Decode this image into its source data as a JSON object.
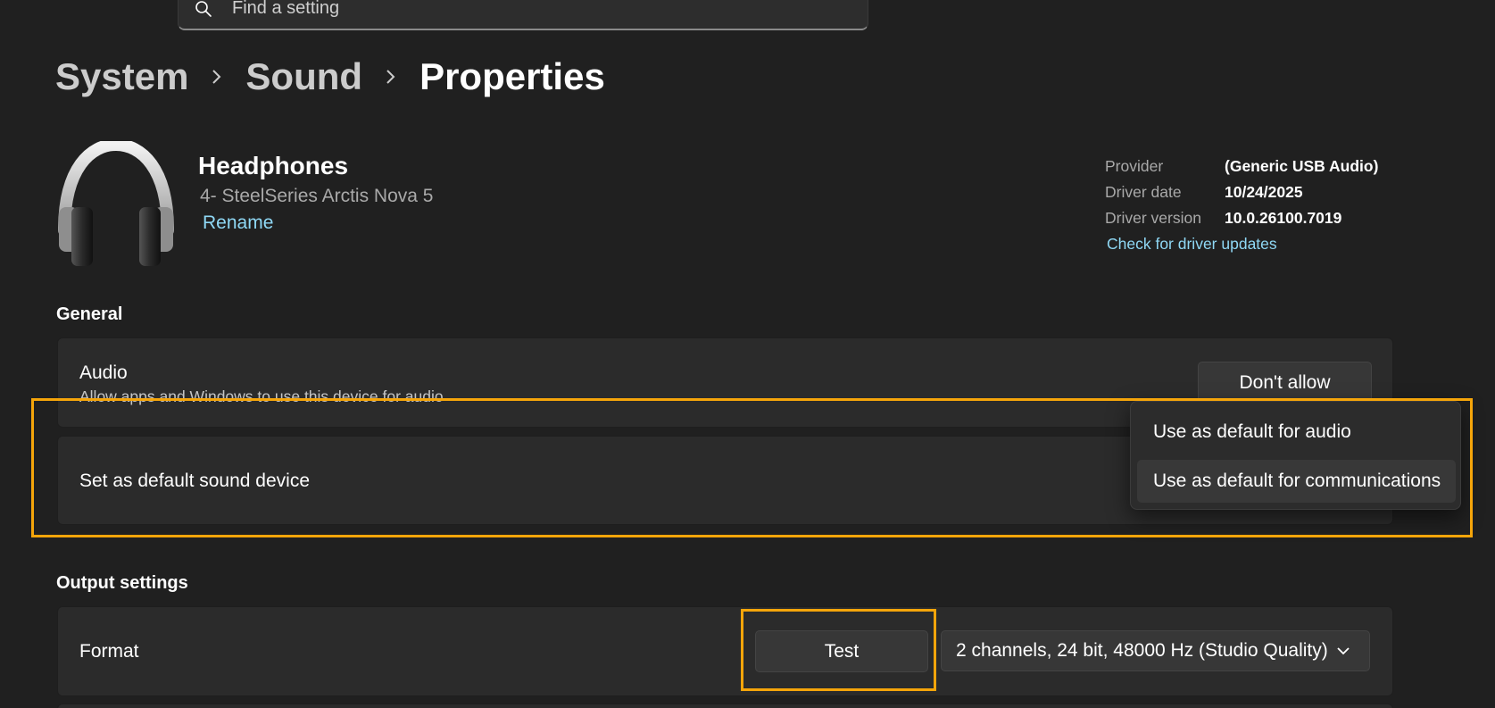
{
  "search": {
    "placeholder": "Find a setting",
    "icon": "search-icon"
  },
  "breadcrumb": {
    "items": [
      "System",
      "Sound",
      "Properties"
    ]
  },
  "device": {
    "icon": "headphones-icon",
    "name": "Headphones",
    "model": "4- SteelSeries Arctis Nova 5",
    "rename_label": "Rename"
  },
  "driver_info": {
    "rows": [
      {
        "label": "Provider",
        "value": "(Generic USB Audio)"
      },
      {
        "label": "Driver date",
        "value": "10/24/2025"
      },
      {
        "label": "Driver version",
        "value": "10.0.26100.7019"
      }
    ],
    "update_link": "Check for driver updates"
  },
  "general": {
    "title": "General",
    "audio": {
      "label": "Audio",
      "description": "Allow apps and Windows to use this device for audio",
      "button": "Don't allow"
    },
    "default_device": {
      "label": "Set as default sound device",
      "menu": [
        "Use as default for audio",
        "Use as default for communications"
      ]
    }
  },
  "output": {
    "title": "Output settings",
    "format": {
      "label": "Format",
      "test_button": "Test",
      "selected": "2 channels, 24 bit, 48000 Hz (Studio Quality)"
    }
  },
  "colors": {
    "background": "#202020",
    "card": "#2b2b2b",
    "accent_link": "#8fd8f5",
    "highlight": "#f5a50a"
  }
}
